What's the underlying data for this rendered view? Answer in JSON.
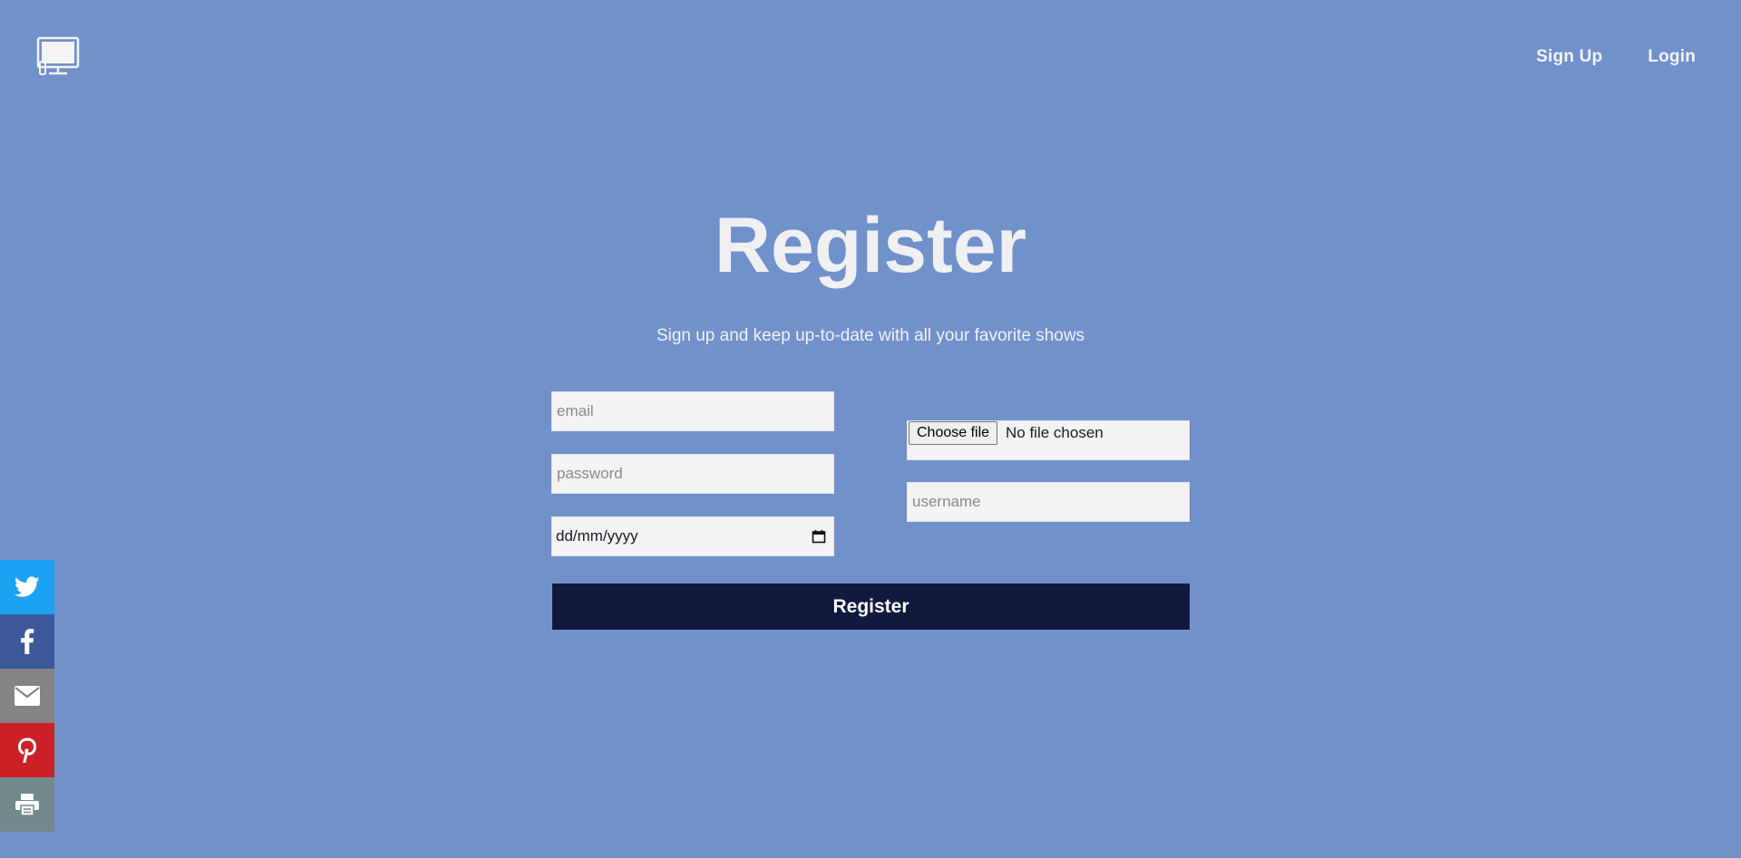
{
  "header": {
    "logo_icon": "monitor-icon",
    "nav": {
      "signup_label": "Sign Up",
      "login_label": "Login"
    }
  },
  "hero": {
    "title": "Register",
    "subtitle": "Sign up and keep up-to-date with all your favorite shows"
  },
  "form": {
    "email_placeholder": "email",
    "password_placeholder": "password",
    "date_value": "dd/mm/yyyy",
    "file_button_label": "Choose file",
    "file_status": "No file chosen",
    "username_placeholder": "username",
    "submit_label": "Register"
  },
  "share_bar": {
    "items": [
      {
        "icon": "twitter-icon",
        "color": "#1da1f2"
      },
      {
        "icon": "facebook-icon",
        "color": "#3b5998"
      },
      {
        "icon": "email-icon",
        "color": "#848484"
      },
      {
        "icon": "pinterest-icon",
        "color": "#cb2027"
      },
      {
        "icon": "print-icon",
        "color": "#738a8d"
      }
    ]
  },
  "colors": {
    "background": "#7191cb",
    "button": "#13183d",
    "input_bg": "#f3f3f3"
  }
}
